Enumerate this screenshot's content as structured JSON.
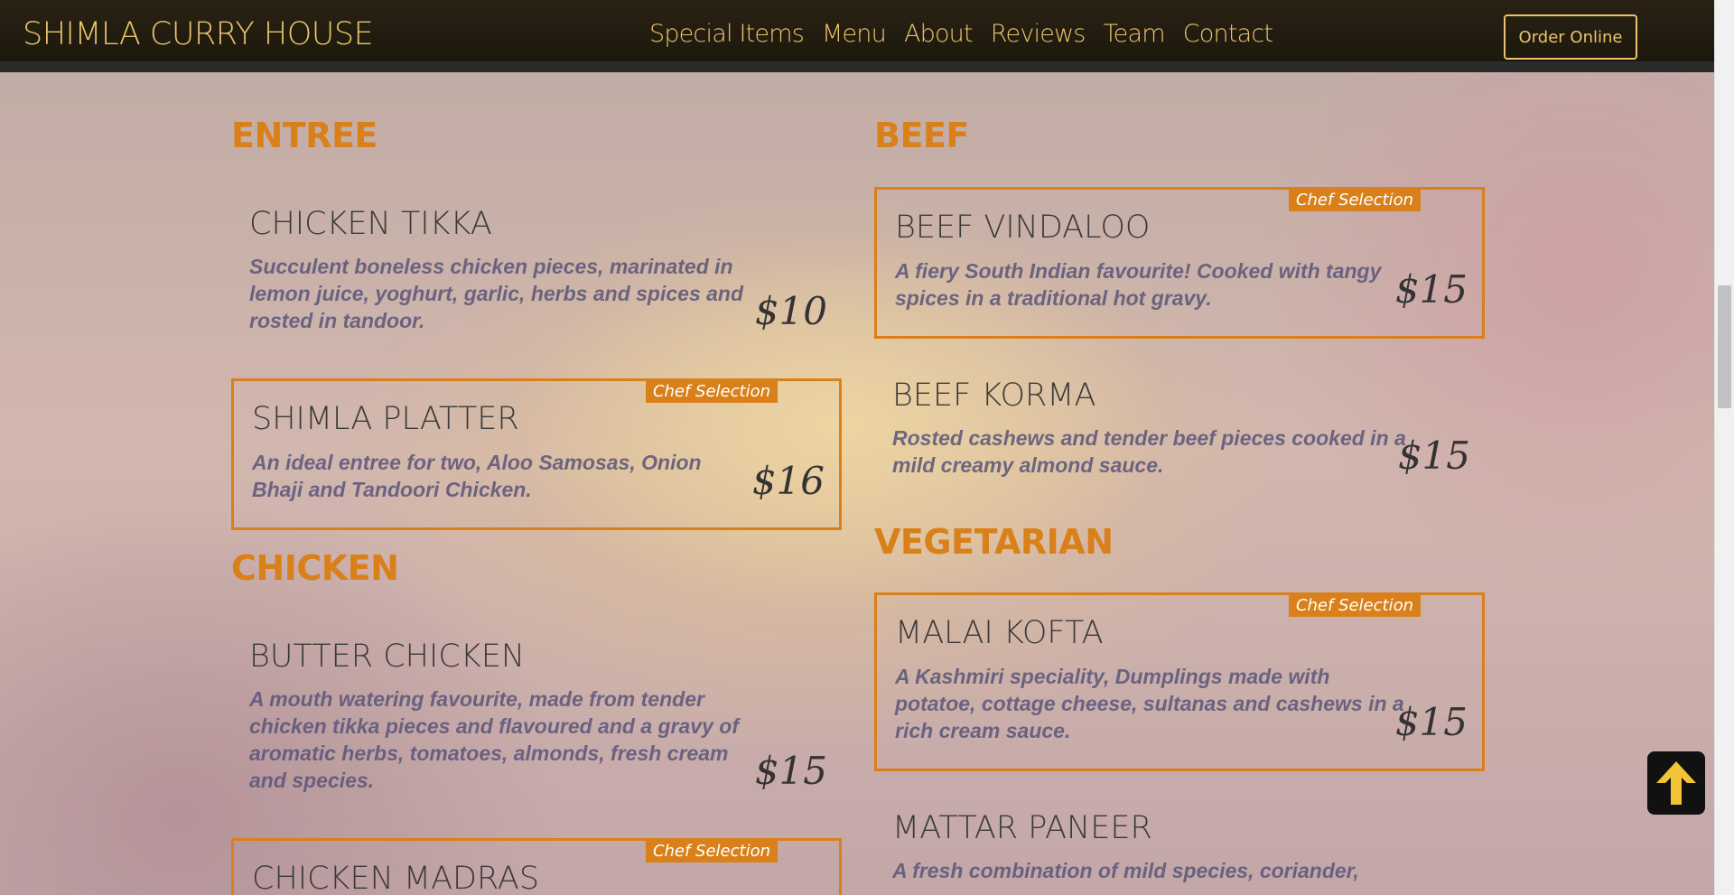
{
  "nav": {
    "brand": "SHIMLA CURRY HOUSE",
    "links": [
      "Special Items",
      "Menu",
      "About",
      "Reviews",
      "Team",
      "Contact"
    ],
    "order_button": "Order Online"
  },
  "menu": {
    "badge_label": "Chef Selection",
    "left": {
      "entree_title": "ENTREE",
      "chicken_title": "CHICKEN",
      "items": [
        {
          "name": "CHICKEN TIKKA",
          "desc": "Succulent boneless chicken pieces, marinated in lemon juice, yoghurt, garlic, herbs and spices and rosted in tandoor.",
          "price": "$10",
          "chef": false
        },
        {
          "name": "SHIMLA PLATTER",
          "desc": "An ideal entree for two, Aloo Samosas, Onion Bhaji and Tandoori Chicken.",
          "price": "$16",
          "chef": true
        },
        {
          "name": "BUTTER CHICKEN",
          "desc": "A mouth watering favourite, made from tender chicken tikka pieces and flavoured and a gravy of aromatic herbs, tomatoes, almonds, fresh cream and species.",
          "price": "$15",
          "chef": false
        },
        {
          "name": "CHICKEN MADRAS",
          "desc": "",
          "price": "",
          "chef": true
        }
      ]
    },
    "right": {
      "beef_title": "BEEF",
      "veg_title": "VEGETARIAN",
      "items": [
        {
          "name": "BEEF VINDALOO",
          "desc": "A fiery South Indian favourite! Cooked with tangy spices in a traditional hot gravy.",
          "price": "$15",
          "chef": true
        },
        {
          "name": "BEEF KORMA",
          "desc": "Rosted cashews and tender beef pieces cooked in a mild creamy almond sauce.",
          "price": "$15",
          "chef": false
        },
        {
          "name": "MALAI KOFTA",
          "desc": "A Kashmiri speciality, Dumplings made with potatoe, cottage cheese, sultanas and cashews in a rich cream sauce.",
          "price": "$15",
          "chef": true
        },
        {
          "name": "MATTAR PANEER",
          "desc": "A fresh combination of mild species, coriander,",
          "price": "",
          "chef": false
        }
      ]
    }
  },
  "colors": {
    "accent": "#d9801a",
    "nav_text": "#e9c46a",
    "nav_bg": "#1c170d"
  },
  "icons": {
    "scroll_top": "arrow-up-icon"
  }
}
